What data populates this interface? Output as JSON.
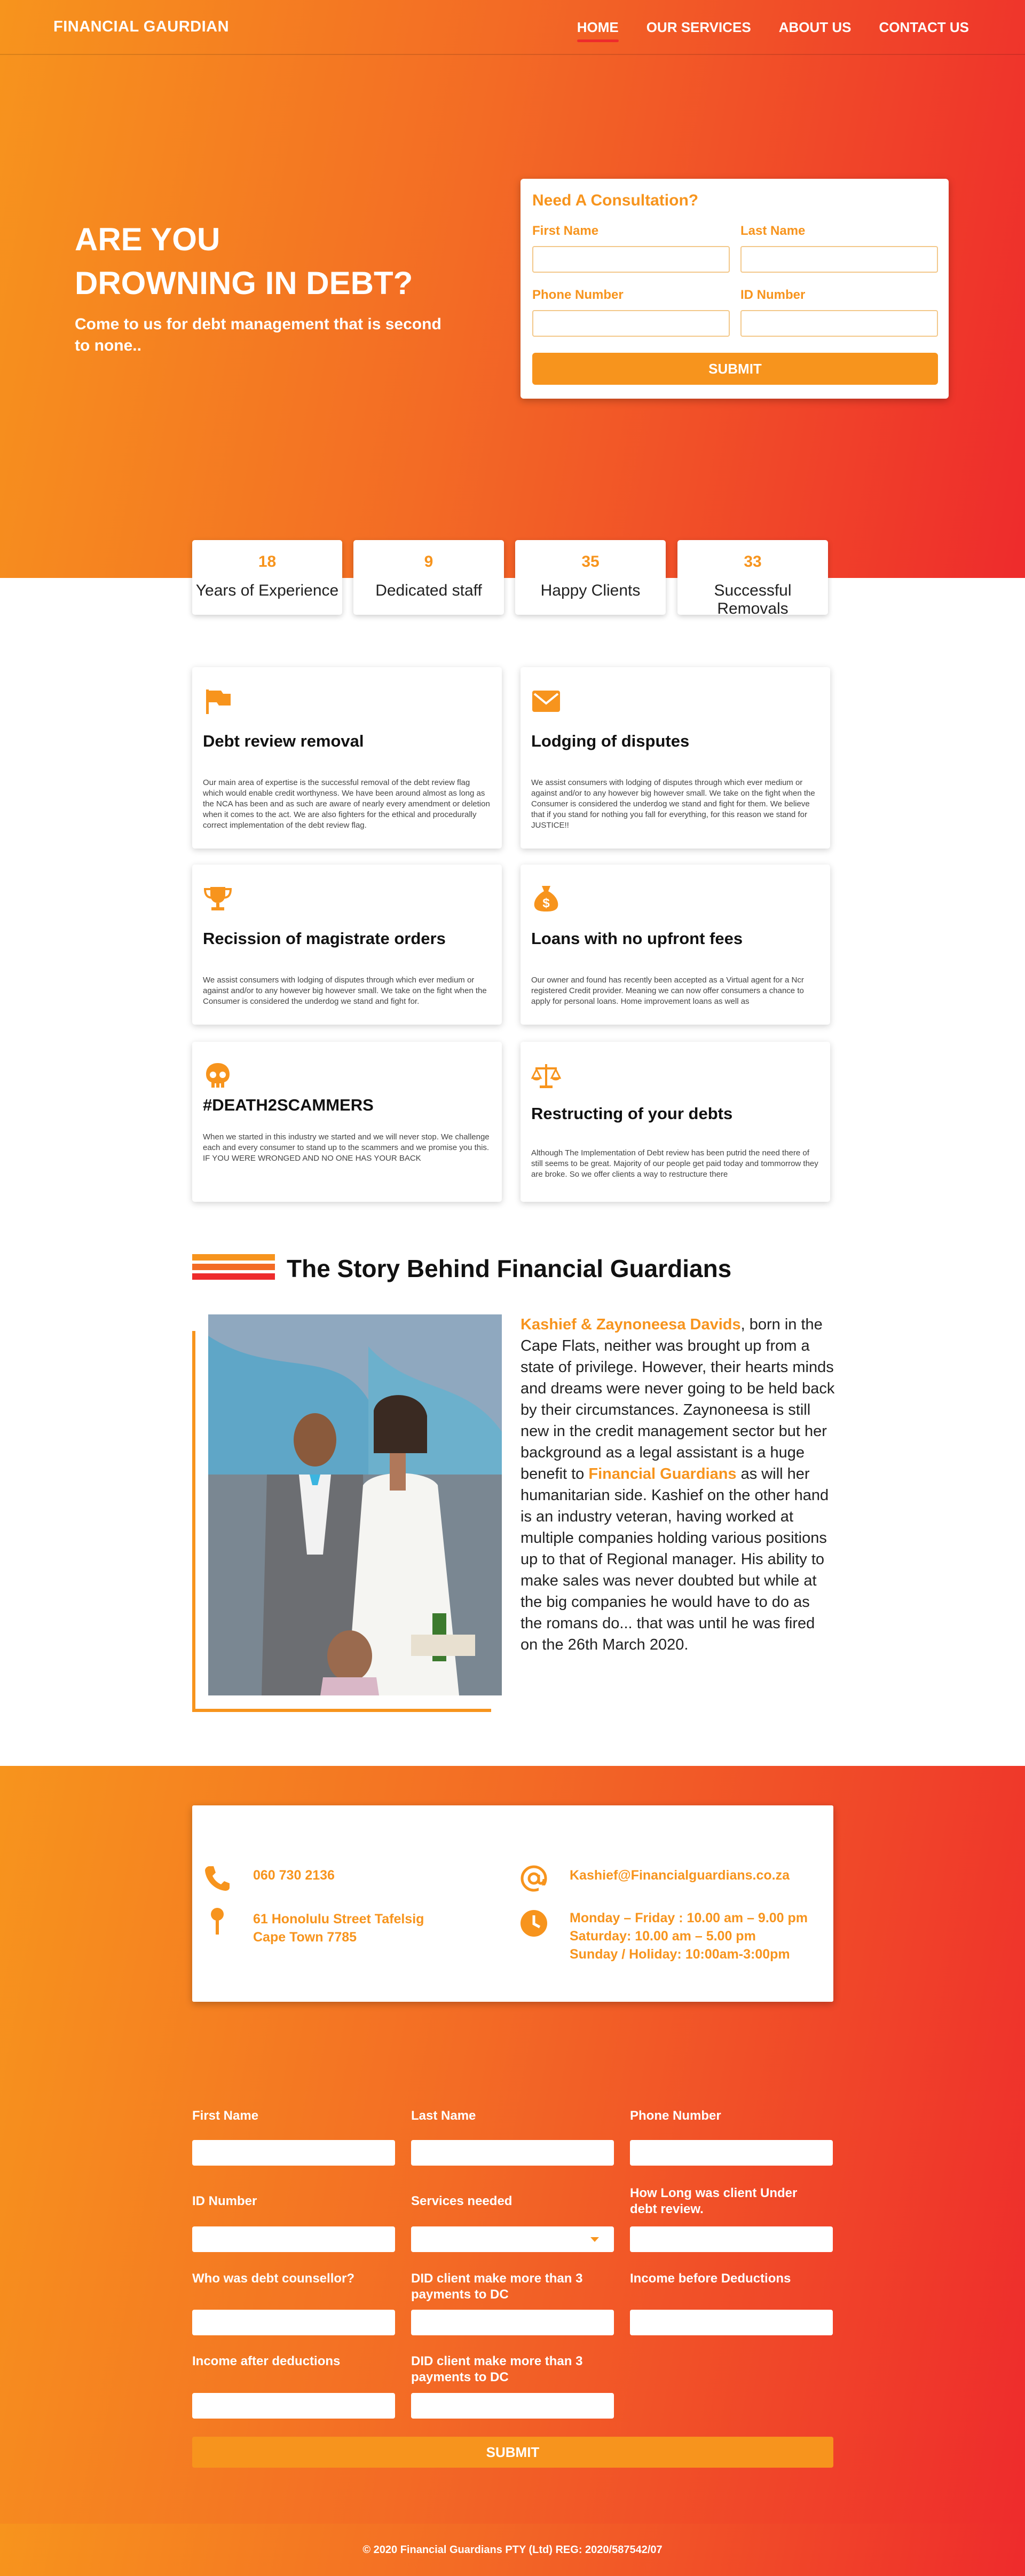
{
  "nav": {
    "brand": "FINANCIAL GAURDIAN",
    "links": [
      "HOME",
      "OUR SERVICES",
      "ABOUT US",
      "CONTACT US"
    ]
  },
  "hero": {
    "title_line1": "ARE YOU",
    "title_line2": "DROWNING IN DEBT?",
    "subtitle": "Come to us for debt management that is second to none.."
  },
  "consult": {
    "title": "Need A Consultation?",
    "first_name": "First Name",
    "last_name": "Last Name",
    "phone": "Phone Number",
    "id_number": "ID Number",
    "submit": "SUBMIT"
  },
  "stats": [
    {
      "value": "18",
      "label": "Years of Experience"
    },
    {
      "value": "9",
      "label": "Dedicated staff"
    },
    {
      "value": "35",
      "label": "Happy Clients"
    },
    {
      "value": "33",
      "label": "Successful Removals"
    }
  ],
  "services": [
    {
      "icon": "flag-icon",
      "title": "Debt review removal",
      "text": "Our main area of expertise is the successful removal of the debt review flag which would enable credit worthyness. We have been around almost as long as the NCA has been and as such are aware of nearly every amendment or deletion when it comes to the act. We are also fighters for the ethical and procedurally correct implementation of the debt review flag."
    },
    {
      "icon": "envelope-icon",
      "title": "Lodging of disputes",
      "text": "We assist consumers with lodging of disputes through which ever medium or against and/or to any however big however small. We take on the fight when the Consumer is considered the underdog we stand and fight for them. We believe that if you stand for nothing you fall for everything, for this reason we stand for JUSTICE!!"
    },
    {
      "icon": "trophy-icon",
      "title": "Recission of magistrate orders",
      "text": "We assist consumers with lodging of disputes through which ever medium or against and/or to any however big however small. We take on the fight when the Consumer is considered the underdog we stand and fight for."
    },
    {
      "icon": "money-bag-icon",
      "title": "Loans with no upfront fees",
      "text": "Our owner and found has recently been accepted as a Virtual agent for a Ncr registered Credit provider. Meaning we can now offer consumers a chance to apply for personal loans. Home improvement loans as well as"
    },
    {
      "icon": "skull-icon",
      "title": "#DEATH2SCAMMERS",
      "text": "When we started in this industry we started and we will never stop. We challenge each and every consumer to stand up to the scammers and we promise you this. IF YOU WERE WRONGED AND NO ONE HAS YOUR BACK"
    },
    {
      "icon": "scales-icon",
      "title": "Restructing of your debts",
      "text": "Although The Implementation of Debt review has been putrid the need there of still seems to be great. Majority of our people get paid today and tommorrow they are broke. So we offer clients a way to restructure there"
    }
  ],
  "story": {
    "title": "The Story Behind Financial Guardians",
    "names": "Kashief & Zaynoneesa Davids",
    "part1": ", born in the Cape Flats, neither was brought up from a state of privilege. However, their hearts minds and dreams were never going to be held back by their circumstances. Zaynoneesa is still new in the credit management sector but her background as a legal assistant is a huge benefit to ",
    "company": "Financial Guardians",
    "part2": " as will her humanitarian side. Kashief on the other hand is an industry veteran, having worked at multiple companies holding various positions up to that of Regional manager. His ability to make sales was never doubted but while at the big companies he would have to do as the romans do... that was until he was fired on the 26th March 2020."
  },
  "contact": {
    "phone": "060 730 2136",
    "address_line1": "61 Honolulu Street Tafelsig",
    "address_line2": "Cape Town 7785",
    "email": "Kashief@Financialguardians.co.za",
    "hours_line1": "Monday – Friday : 10.00 am – 9.00 pm",
    "hours_line2": "Saturday: 10.00 am – 5.00 pm",
    "hours_line3": "Sunday / Holiday: 10:00am-3:00pm"
  },
  "form": {
    "first_name": "First Name",
    "last_name": "Last Name",
    "phone": "Phone Number",
    "id_number": "ID Number",
    "services": "Services needed",
    "how_long_1": "How Long was client Under",
    "how_long_2": " debt review.",
    "counsellor": "Who was debt counsellor?",
    "did1_line1": "DID client make more than 3",
    "did1_line2": "payments to DC",
    "income_before": "Income before Deductions",
    "income_after": "Income after deductions",
    "did2_line1": "DID client make more than 3",
    "did2_line2": "payments to DC",
    "submit": "SUBMIT"
  },
  "footer": {
    "text": "© 2020 Financial Guardians PTY (Ltd) REG: 2020/587542/07"
  }
}
